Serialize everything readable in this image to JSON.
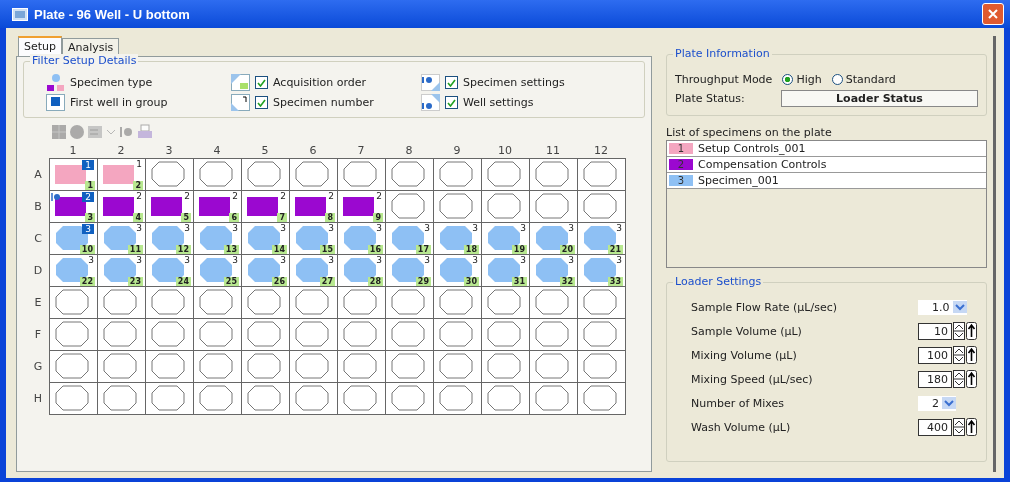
{
  "window": {
    "title": "Plate - 96 Well - U bottom"
  },
  "tabs": [
    {
      "label": "Setup",
      "selected": true
    },
    {
      "label": "Analysis",
      "selected": false
    }
  ],
  "filter": {
    "title": "Filter Setup Details",
    "items": [
      {
        "kind": "legend",
        "label": "Specimen type"
      },
      {
        "kind": "check",
        "label": "Acquisition order",
        "checked": true
      },
      {
        "kind": "check",
        "label": "Specimen settings",
        "checked": true
      },
      {
        "kind": "legend",
        "label": "First well in group"
      },
      {
        "kind": "check",
        "label": "Specimen number",
        "checked": true
      },
      {
        "kind": "check",
        "label": "Well settings",
        "checked": true
      }
    ]
  },
  "plate": {
    "columns": [
      "1",
      "2",
      "3",
      "4",
      "5",
      "6",
      "7",
      "8",
      "9",
      "10",
      "11",
      "12"
    ],
    "rows": [
      {
        "label": "A",
        "wells": [
          {
            "kind": "square",
            "color": "#f4a6c0",
            "number": "1",
            "first": true,
            "order": "1"
          },
          {
            "kind": "square",
            "color": "#f4a6c0",
            "number": "1",
            "first": false,
            "order": "2"
          },
          {
            "kind": "empty"
          },
          {
            "kind": "empty"
          },
          {
            "kind": "empty"
          },
          {
            "kind": "empty"
          },
          {
            "kind": "empty"
          },
          {
            "kind": "empty"
          },
          {
            "kind": "empty"
          },
          {
            "kind": "empty"
          },
          {
            "kind": "empty"
          },
          {
            "kind": "empty"
          }
        ]
      },
      {
        "label": "B",
        "wells": [
          {
            "kind": "square",
            "color": "#9b08d0",
            "number": "2",
            "first": true,
            "order": "3",
            "settings": true
          },
          {
            "kind": "square",
            "color": "#9b08d0",
            "number": "2",
            "first": false,
            "order": "4"
          },
          {
            "kind": "square",
            "color": "#9b08d0",
            "number": "2",
            "first": false,
            "order": "5"
          },
          {
            "kind": "square",
            "color": "#9b08d0",
            "number": "2",
            "first": false,
            "order": "6"
          },
          {
            "kind": "square",
            "color": "#9b08d0",
            "number": "2",
            "first": false,
            "order": "7"
          },
          {
            "kind": "square",
            "color": "#9b08d0",
            "number": "2",
            "first": false,
            "order": "8"
          },
          {
            "kind": "square",
            "color": "#9b08d0",
            "number": "2",
            "first": false,
            "order": "9"
          },
          {
            "kind": "empty"
          },
          {
            "kind": "empty"
          },
          {
            "kind": "empty"
          },
          {
            "kind": "empty"
          },
          {
            "kind": "empty"
          }
        ]
      },
      {
        "label": "C",
        "wells": [
          {
            "kind": "round",
            "color": "#8ec0f4",
            "number": "3",
            "first": true,
            "order": "10"
          },
          {
            "kind": "round",
            "color": "#8ec0f4",
            "number": "3",
            "first": false,
            "order": "11"
          },
          {
            "kind": "round",
            "color": "#8ec0f4",
            "number": "3",
            "first": false,
            "order": "12"
          },
          {
            "kind": "round",
            "color": "#8ec0f4",
            "number": "3",
            "first": false,
            "order": "13"
          },
          {
            "kind": "round",
            "color": "#8ec0f4",
            "number": "3",
            "first": false,
            "order": "14"
          },
          {
            "kind": "round",
            "color": "#8ec0f4",
            "number": "3",
            "first": false,
            "order": "15"
          },
          {
            "kind": "round",
            "color": "#8ec0f4",
            "number": "3",
            "first": false,
            "order": "16"
          },
          {
            "kind": "round",
            "color": "#8ec0f4",
            "number": "3",
            "first": false,
            "order": "17"
          },
          {
            "kind": "round",
            "color": "#8ec0f4",
            "number": "3",
            "first": false,
            "order": "18"
          },
          {
            "kind": "round",
            "color": "#8ec0f4",
            "number": "3",
            "first": false,
            "order": "19"
          },
          {
            "kind": "round",
            "color": "#8ec0f4",
            "number": "3",
            "first": false,
            "order": "20"
          },
          {
            "kind": "round",
            "color": "#8ec0f4",
            "number": "3",
            "first": false,
            "order": "21"
          }
        ]
      },
      {
        "label": "D",
        "wells": [
          {
            "kind": "round",
            "color": "#8ec0f4",
            "number": "3",
            "first": false,
            "order": "22"
          },
          {
            "kind": "round",
            "color": "#8ec0f4",
            "number": "3",
            "first": false,
            "order": "23"
          },
          {
            "kind": "round",
            "color": "#8ec0f4",
            "number": "3",
            "first": false,
            "order": "24"
          },
          {
            "kind": "round",
            "color": "#8ec0f4",
            "number": "3",
            "first": false,
            "order": "25"
          },
          {
            "kind": "round",
            "color": "#8ec0f4",
            "number": "3",
            "first": false,
            "order": "26"
          },
          {
            "kind": "round",
            "color": "#8ec0f4",
            "number": "3",
            "first": false,
            "order": "27"
          },
          {
            "kind": "round",
            "color": "#8ec0f4",
            "number": "3",
            "first": false,
            "order": "28"
          },
          {
            "kind": "round",
            "color": "#8ec0f4",
            "number": "3",
            "first": false,
            "order": "29"
          },
          {
            "kind": "round",
            "color": "#8ec0f4",
            "number": "3",
            "first": false,
            "order": "30"
          },
          {
            "kind": "round",
            "color": "#8ec0f4",
            "number": "3",
            "first": false,
            "order": "31"
          },
          {
            "kind": "round",
            "color": "#8ec0f4",
            "number": "3",
            "first": false,
            "order": "32"
          },
          {
            "kind": "round",
            "color": "#8ec0f4",
            "number": "3",
            "first": false,
            "order": "33"
          }
        ]
      },
      {
        "label": "E",
        "wells": [
          {
            "kind": "empty"
          },
          {
            "kind": "empty"
          },
          {
            "kind": "empty"
          },
          {
            "kind": "empty"
          },
          {
            "kind": "empty"
          },
          {
            "kind": "empty"
          },
          {
            "kind": "empty"
          },
          {
            "kind": "empty"
          },
          {
            "kind": "empty"
          },
          {
            "kind": "empty"
          },
          {
            "kind": "empty"
          },
          {
            "kind": "empty"
          }
        ]
      },
      {
        "label": "F",
        "wells": [
          {
            "kind": "empty"
          },
          {
            "kind": "empty"
          },
          {
            "kind": "empty"
          },
          {
            "kind": "empty"
          },
          {
            "kind": "empty"
          },
          {
            "kind": "empty"
          },
          {
            "kind": "empty"
          },
          {
            "kind": "empty"
          },
          {
            "kind": "empty"
          },
          {
            "kind": "empty"
          },
          {
            "kind": "empty"
          },
          {
            "kind": "empty"
          }
        ]
      },
      {
        "label": "G",
        "wells": [
          {
            "kind": "empty"
          },
          {
            "kind": "empty"
          },
          {
            "kind": "empty"
          },
          {
            "kind": "empty"
          },
          {
            "kind": "empty"
          },
          {
            "kind": "empty"
          },
          {
            "kind": "empty"
          },
          {
            "kind": "empty"
          },
          {
            "kind": "empty"
          },
          {
            "kind": "empty"
          },
          {
            "kind": "empty"
          },
          {
            "kind": "empty"
          }
        ]
      },
      {
        "label": "H",
        "wells": [
          {
            "kind": "empty"
          },
          {
            "kind": "empty"
          },
          {
            "kind": "empty"
          },
          {
            "kind": "empty"
          },
          {
            "kind": "empty"
          },
          {
            "kind": "empty"
          },
          {
            "kind": "empty"
          },
          {
            "kind": "empty"
          },
          {
            "kind": "empty"
          },
          {
            "kind": "empty"
          },
          {
            "kind": "empty"
          },
          {
            "kind": "empty"
          }
        ]
      }
    ]
  },
  "plate_information": {
    "title": "Plate Information",
    "throughput_label": "Throughput Mode",
    "modes": [
      {
        "label": "High",
        "selected": true
      },
      {
        "label": "Standard",
        "selected": false
      }
    ],
    "status_label": "Plate Status:",
    "status": "Loader Status"
  },
  "specimens": {
    "title": "List of specimens on the plate",
    "items": [
      {
        "number": "1",
        "name": "Setup Controls_001",
        "color": "#f4a6c0"
      },
      {
        "number": "2",
        "name": "Compensation Controls",
        "color": "#9b08d0"
      },
      {
        "number": "3",
        "name": "Specimen_001",
        "color": "#8ec0f4"
      }
    ]
  },
  "loader_settings": {
    "title": "Loader Settings",
    "fields": [
      {
        "kind": "dropdown",
        "label": "Sample Flow Rate (µL/sec)",
        "value": "1.0"
      },
      {
        "kind": "spinner",
        "label": "Sample Volume (µL)",
        "value": "10"
      },
      {
        "kind": "spinner",
        "label": "Mixing Volume (µL)",
        "value": "100"
      },
      {
        "kind": "spinner",
        "label": "Mixing Speed (µL/sec)",
        "value": "180"
      },
      {
        "kind": "dropdown",
        "label": "Number of Mixes",
        "value": "2"
      },
      {
        "kind": "spinner",
        "label": "Wash Volume (µL)",
        "value": "400"
      }
    ]
  }
}
